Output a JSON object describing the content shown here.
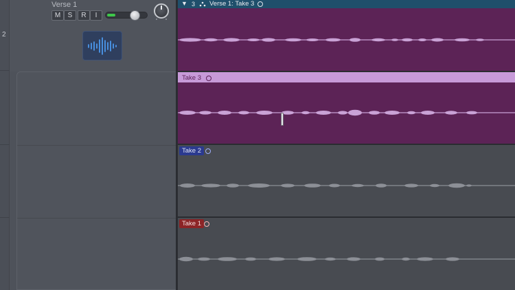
{
  "track_header": {
    "number": "2",
    "name": "Verse 1",
    "buttons": [
      "M",
      "S",
      "R",
      "I"
    ],
    "volume_level": 0.2
  },
  "comp": {
    "count": "3",
    "name": "Verse 1: Take 3"
  },
  "takes": [
    {
      "label": "Take 3",
      "selected": true,
      "color": "#c79ad8"
    },
    {
      "label": "Take 2",
      "selected": false,
      "color": "#2b3a8f"
    },
    {
      "label": "Take 1",
      "selected": false,
      "color": "#8c2426"
    }
  ],
  "colors": {
    "comp_header": "#1f4f6b",
    "take3_lane": "#5c2356",
    "inactive_lane": "#484b51",
    "waveform_active": "#c9a2d6",
    "waveform_inactive": "#8c8f96",
    "volume_meter": "#3ec84a"
  },
  "icons": {
    "audio_track": "audio-waveform-icon",
    "comp_disclosure": "disclosure-triangle-icon",
    "comp_type": "quick-swipe-comping-icon",
    "loop": "loop-icon"
  }
}
